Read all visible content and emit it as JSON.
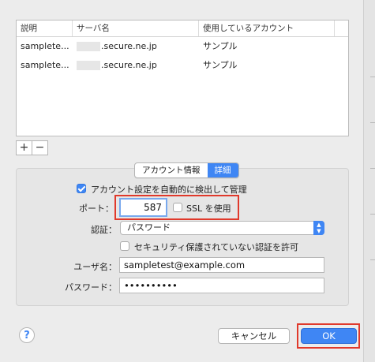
{
  "table": {
    "headers": [
      "説明",
      "サーバ名",
      "使用しているアカウント"
    ],
    "rows": [
      {
        "description": "samplete...",
        "server": ".secure.ne.jp",
        "account": "サンプル"
      },
      {
        "description": "samplete...",
        "server": ".secure.ne.jp",
        "account": "サンプル"
      }
    ]
  },
  "list_controls": {
    "add": "+",
    "remove": "−"
  },
  "tabs": [
    {
      "label": "アカウント情報",
      "selected": false
    },
    {
      "label": "詳細",
      "selected": true
    }
  ],
  "settings": {
    "auto_detect_label": "アカウント設定を自動的に検出して管理",
    "auto_detect_checked": true,
    "port_label": "ポート：",
    "port_value": "587",
    "ssl_label": "SSL を使用",
    "ssl_checked": false,
    "auth_label": "認証：",
    "auth_value": "パスワード",
    "allow_insecure_label": "セキュリティ保護されていない認証を許可",
    "allow_insecure_checked": false,
    "username_label": "ユーザ名：",
    "username_value": "sampletest@example.com",
    "password_label": "パスワード：",
    "password_value": "••••••••••"
  },
  "footer": {
    "help": "?",
    "cancel": "キャンセル",
    "ok": "OK"
  },
  "colors": {
    "accent": "#3f86f4",
    "highlight": "#e0392b"
  }
}
